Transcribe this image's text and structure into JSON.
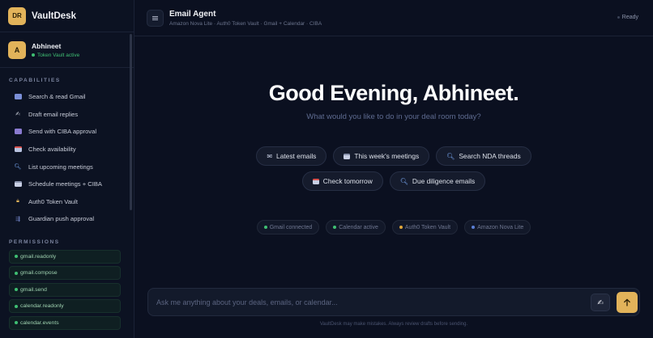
{
  "brand": {
    "logo": "DR",
    "name": "VaultDesk"
  },
  "user": {
    "avatar": "A",
    "name": "Abhineet",
    "status": "Token Vault active"
  },
  "capabilities": {
    "title": "CAPABILITIES",
    "items": [
      {
        "label": "Search & read Gmail",
        "icon": "envelope-icon"
      },
      {
        "label": "Draft email replies",
        "icon": "writing-hand-icon"
      },
      {
        "label": "Send with CIBA approval",
        "icon": "ballot-box-icon"
      },
      {
        "label": "Check availability",
        "icon": "calendar-icon"
      },
      {
        "label": "List upcoming meetings",
        "icon": "magnifier-icon"
      },
      {
        "label": "Schedule meetings + CIBA",
        "icon": "spiral-calendar-icon"
      },
      {
        "label": "Auth0 Token Vault",
        "icon": "lock-icon"
      },
      {
        "label": "Guardian push approval",
        "icon": "phone-arrow-icon"
      }
    ]
  },
  "permissions": {
    "title": "PERMISSIONS",
    "items": [
      "gmail.readonly",
      "gmail.compose",
      "gmail.send",
      "calendar.readonly",
      "calendar.events"
    ]
  },
  "header": {
    "title": "Email Agent",
    "subtitle": "Amazon Nova Lite · Auth0 Token Vault · Gmail + Calendar · CIBA",
    "status": "Ready"
  },
  "greeting": {
    "title": "Good Evening, Abhineet.",
    "subtitle": "What would you like to do in your deal room today?"
  },
  "suggestions": [
    {
      "label": "Latest emails",
      "icon": "envelope-icon"
    },
    {
      "label": "This week's meetings",
      "icon": "calendar-icon"
    },
    {
      "label": "Search NDA threads",
      "icon": "magnifier-icon"
    },
    {
      "label": "Check tomorrow",
      "icon": "calendar-icon"
    },
    {
      "label": "Due diligence emails",
      "icon": "magnifier-icon"
    }
  ],
  "integrations": [
    {
      "label": "Gmail connected",
      "color": "#3fbf73"
    },
    {
      "label": "Calendar active",
      "color": "#3fbf73"
    },
    {
      "label": "Auth0 Token Vault",
      "color": "#e0a73a"
    },
    {
      "label": "Amazon Nova Lite",
      "color": "#5b7fd6"
    }
  ],
  "composer": {
    "placeholder": "Ask me anything about your deals, emails, or calendar...",
    "draft_icon": "writing-hand-icon",
    "send_icon": "arrow-up-icon"
  },
  "footer": {
    "disclaimer": "VaultDesk may make mistakes. Always review drafts before sending."
  },
  "colors": {
    "accent": "#e2b35a",
    "background": "#0b1020",
    "success": "#3fbf73"
  }
}
